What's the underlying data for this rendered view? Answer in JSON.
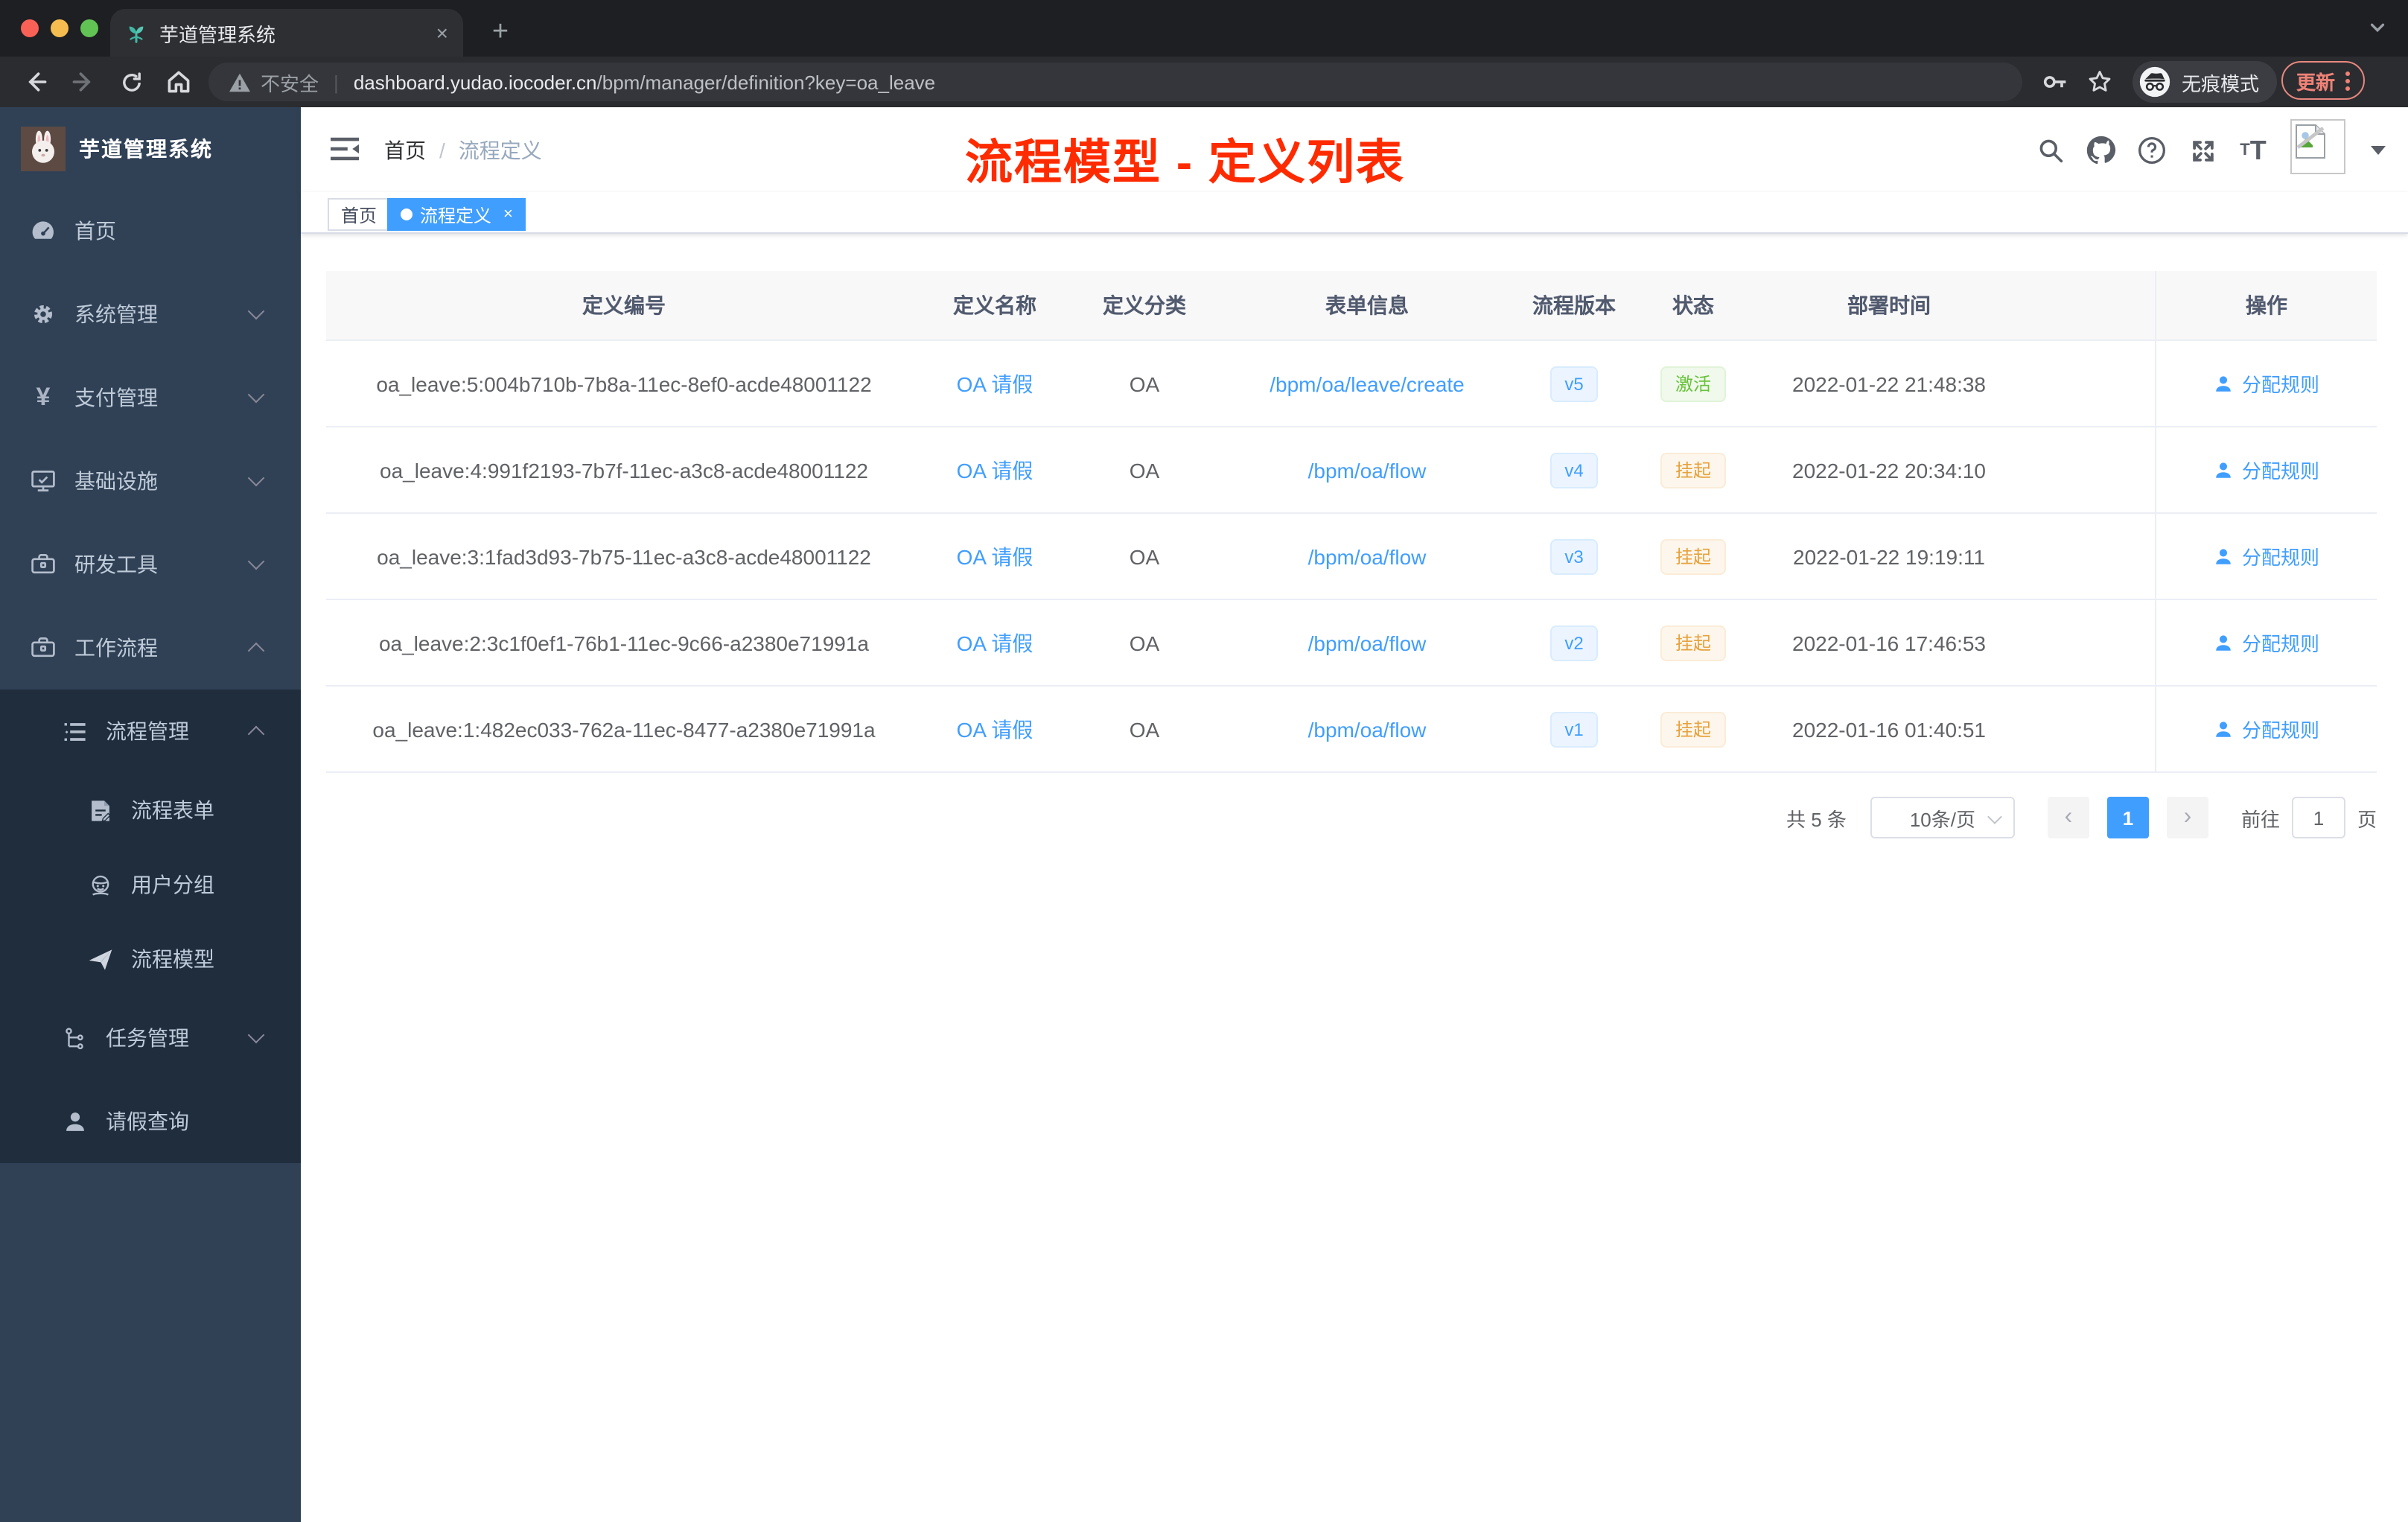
{
  "colors": {
    "accent": "#409eff",
    "success": "#67c23a",
    "warning": "#e6a23c",
    "title_red": "#fe2b00",
    "sidebar_bg": "#304156",
    "submenu_bg": "#1f2d3d"
  },
  "browser": {
    "tab_title": "芋道管理系统",
    "close_glyph": "×",
    "new_tab_glyph": "+",
    "security_label": "不安全",
    "url_host": "dashboard.yudao.iocoder.cn",
    "url_path": "/bpm/manager/definition?key=oa_leave",
    "incognito_label": "无痕模式",
    "update_label": "更新"
  },
  "sidebar": {
    "brand": "芋道管理系统",
    "items": [
      {
        "label": "首页",
        "icon": "dashboard-icon"
      },
      {
        "label": "系统管理",
        "icon": "gear-icon",
        "chevron": "down"
      },
      {
        "label": "支付管理",
        "icon": "yen-icon",
        "chevron": "down",
        "yen": "¥"
      },
      {
        "label": "基础设施",
        "icon": "monitor-icon",
        "chevron": "down"
      },
      {
        "label": "研发工具",
        "icon": "toolbox-icon",
        "chevron": "down"
      },
      {
        "label": "工作流程",
        "icon": "briefcase-icon",
        "chevron": "up"
      },
      {
        "label": "流程管理",
        "icon": "list-icon",
        "chevron": "up"
      },
      {
        "label": "流程表单",
        "icon": "form-icon"
      },
      {
        "label": "用户分组",
        "icon": "user-group-icon"
      },
      {
        "label": "流程模型",
        "icon": "paper-plane-icon"
      },
      {
        "label": "任务管理",
        "icon": "tree-icon",
        "chevron": "down"
      },
      {
        "label": "请假查询",
        "icon": "person-icon"
      }
    ]
  },
  "header": {
    "breadcrumb": {
      "home": "首页",
      "sep": "/",
      "current": "流程定义"
    },
    "overlay_title": "流程模型 - 定义列表"
  },
  "tags": [
    {
      "label": "首页",
      "active": false
    },
    {
      "label": "流程定义",
      "active": true,
      "close": "×"
    }
  ],
  "table": {
    "columns": [
      "定义编号",
      "定义名称",
      "定义分类",
      "表单信息",
      "流程版本",
      "状态",
      "部署时间",
      "操作"
    ],
    "rows": [
      {
        "id": "oa_leave:5:004b710b-7b8a-11ec-8ef0-acde48001122",
        "name": "OA 请假",
        "category": "OA",
        "form": "/bpm/oa/leave/create",
        "version": "v5",
        "status": "激活",
        "status_type": "success",
        "deployed_at": "2022-01-22 21:48:38",
        "action": "分配规则"
      },
      {
        "id": "oa_leave:4:991f2193-7b7f-11ec-a3c8-acde48001122",
        "name": "OA 请假",
        "category": "OA",
        "form": "/bpm/oa/flow",
        "version": "v4",
        "status": "挂起",
        "status_type": "warning",
        "deployed_at": "2022-01-22 20:34:10",
        "action": "分配规则"
      },
      {
        "id": "oa_leave:3:1fad3d93-7b75-11ec-a3c8-acde48001122",
        "name": "OA 请假",
        "category": "OA",
        "form": "/bpm/oa/flow",
        "version": "v3",
        "status": "挂起",
        "status_type": "warning",
        "deployed_at": "2022-01-22 19:19:11",
        "action": "分配规则"
      },
      {
        "id": "oa_leave:2:3c1f0ef1-76b1-11ec-9c66-a2380e71991a",
        "name": "OA 请假",
        "category": "OA",
        "form": "/bpm/oa/flow",
        "version": "v2",
        "status": "挂起",
        "status_type": "warning",
        "deployed_at": "2022-01-16 17:46:53",
        "action": "分配规则"
      },
      {
        "id": "oa_leave:1:482ec033-762a-11ec-8477-a2380e71991a",
        "name": "OA 请假",
        "category": "OA",
        "form": "/bpm/oa/flow",
        "version": "v1",
        "status": "挂起",
        "status_type": "warning",
        "deployed_at": "2022-01-16 01:40:51",
        "action": "分配规则"
      }
    ]
  },
  "pagination": {
    "total": "共 5 条",
    "page_size": "10条/页",
    "prev": "‹",
    "current": "1",
    "next": "›",
    "goto": "前往",
    "page_unit": "页",
    "goto_value": "1"
  }
}
